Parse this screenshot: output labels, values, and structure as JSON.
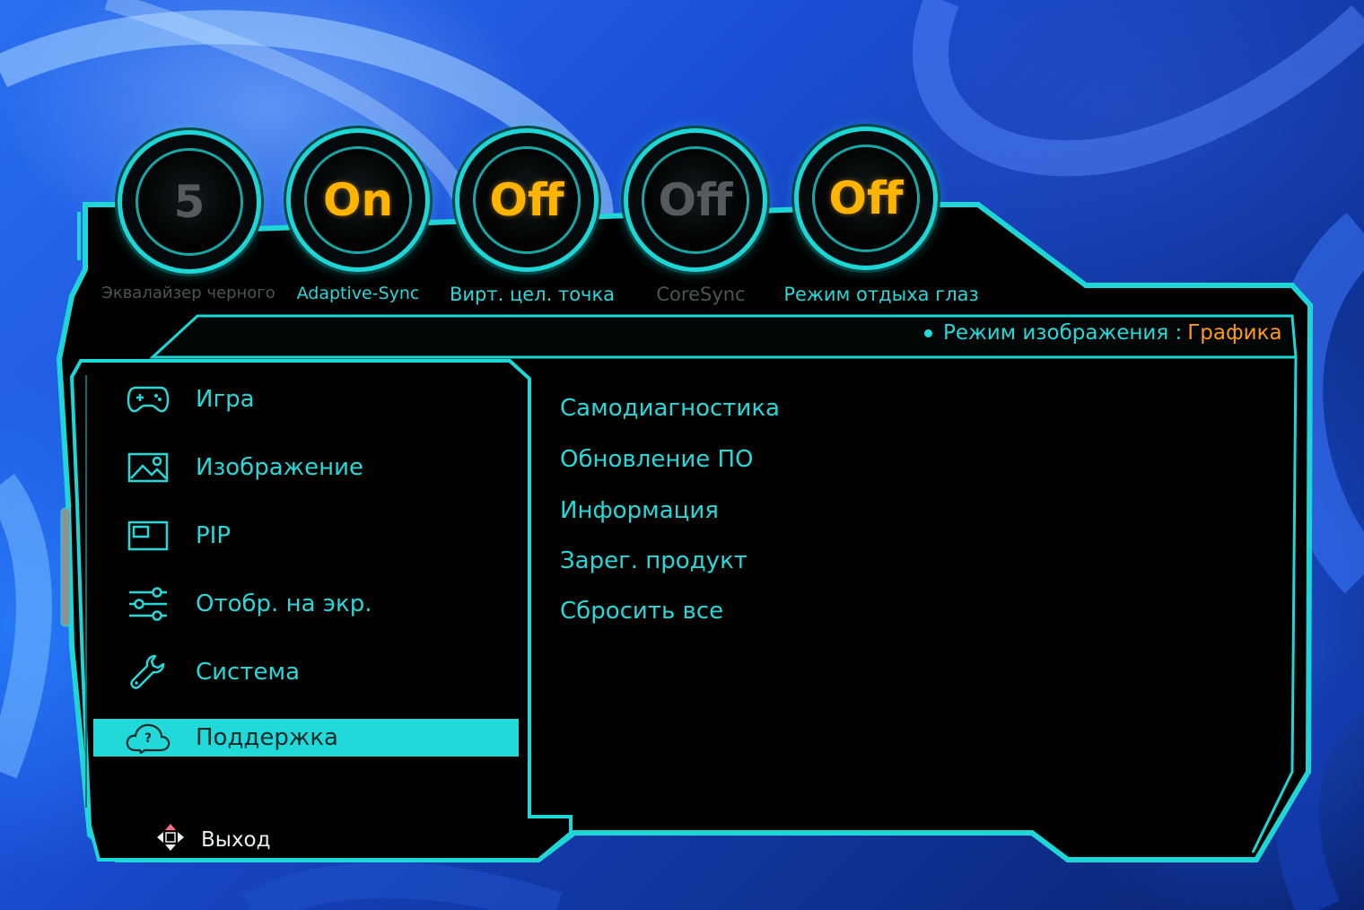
{
  "dials": [
    {
      "value": "5",
      "label": "Эквалайзер черного",
      "active": false
    },
    {
      "value": "On",
      "label": "Adaptive-Sync",
      "active": true
    },
    {
      "value": "Off",
      "label": "Вирт. цел. точка",
      "active": true
    },
    {
      "value": "Off",
      "label": "CoreSync",
      "active": false
    },
    {
      "value": "Off",
      "label": "Режим отдыха глаз",
      "active": true
    }
  ],
  "picture_mode": {
    "label": "Режим изображения :",
    "value": "Графика"
  },
  "menu": {
    "items": [
      {
        "label": "Игра",
        "icon": "gamepad-icon"
      },
      {
        "label": "Изображение",
        "icon": "picture-icon"
      },
      {
        "label": "PIP",
        "icon": "pip-icon"
      },
      {
        "label": "Отобр. на экр.",
        "icon": "sliders-icon"
      },
      {
        "label": "Система",
        "icon": "wrench-icon"
      },
      {
        "label": "Поддержка",
        "icon": "support-cloud-icon",
        "selected": true
      }
    ],
    "selected_index": 5
  },
  "submenu": {
    "items": [
      {
        "label": "Самодиагностика"
      },
      {
        "label": "Обновление ПО"
      },
      {
        "label": "Информация"
      },
      {
        "label": "Зарег. продукт"
      },
      {
        "label": "Сбросить все"
      }
    ]
  },
  "footer": {
    "exit_label": "Выход",
    "exit_icon": "four-way-arrows-icon"
  },
  "colors": {
    "accent": "#21d9d9",
    "value_on": "#ffb400",
    "mode_value": "#ff9a1e",
    "panel": "#000000"
  }
}
